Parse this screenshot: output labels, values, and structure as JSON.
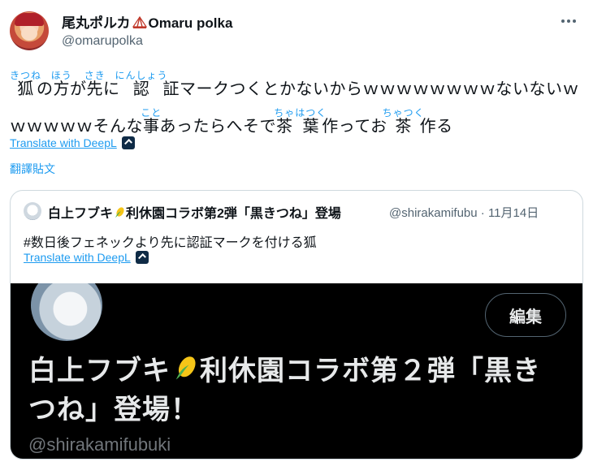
{
  "author": {
    "name_prefix": "尾丸ポルカ",
    "name_suffix": "Omaru polka",
    "handle": "@omarupolka"
  },
  "tweet": {
    "line1": [
      {
        "base": "狐",
        "ruby": "きつね"
      },
      {
        "text": "の"
      },
      {
        "base": "方",
        "ruby": "ほう"
      },
      {
        "text": "が"
      },
      {
        "base": "先",
        "ruby": "さき"
      },
      {
        "text": "に"
      },
      {
        "base": "認",
        "ruby": "にんしょう"
      },
      {
        "text": "証マークつくとかないからｗｗｗｗｗｗｗｗないないｗ"
      }
    ],
    "line2": [
      {
        "text": "ｗｗｗｗｗそんな"
      },
      {
        "base": "事",
        "ruby": "こと"
      },
      {
        "text": "あったらへそで"
      },
      {
        "base": "茶",
        "ruby": "ちゃ"
      },
      {
        "base": "葉",
        "ruby": "はつく"
      },
      {
        "text": "作ってお"
      },
      {
        "base": "茶",
        "ruby": "ちゃつく"
      },
      {
        "text": "作る"
      }
    ],
    "translate_deepl": "Translate with DeepL",
    "translate_tweet": "翻譯貼文"
  },
  "quote": {
    "name_prefix": "白上フブキ",
    "name_suffix": "利休園コラボ第2弾「黒きつね」登場",
    "handle": "@shirakamifubu",
    "date": "· 11月14日",
    "text": "#数日後フェネックより先に認証マークを付ける狐",
    "translate_deepl": "Translate with DeepL",
    "media": {
      "edit_button": "編集",
      "title_prefix": "白上フブキ",
      "title_suffix": "利休園コラボ第２弾「黒きつね」登場！",
      "handle": "@shirakamifubuki"
    }
  },
  "icons": {
    "more": "more-dots-icon",
    "deepl": "deepl-icon",
    "tent": "circus-tent-icon",
    "corn": "corn-icon"
  },
  "colors": {
    "accent": "#1d9bf0",
    "muted": "#536471",
    "media_bg": "#000000"
  }
}
